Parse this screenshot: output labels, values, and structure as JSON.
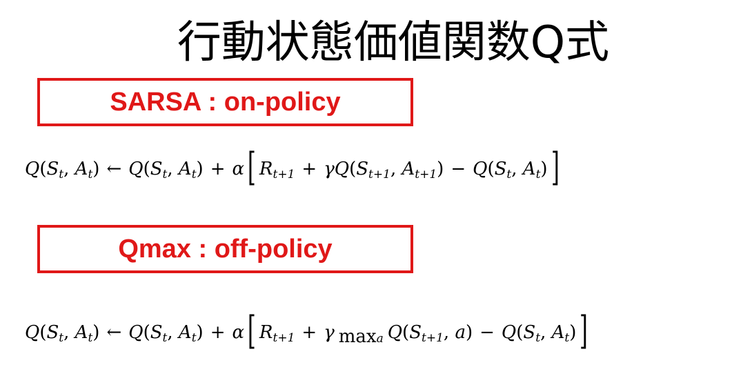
{
  "title": "行動状態価値関数Q式",
  "sections": {
    "sarsa": {
      "label": "SARSA : on-policy",
      "equation": "Q(S_t, A_t) ← Q(S_t, A_t) + α[R_{t+1} + γQ(S_{t+1}, A_{t+1}) − Q(S_t, A_t)]"
    },
    "qmax": {
      "label": "Qmax : off-policy",
      "equation": "Q(S_t, A_t) ← Q(S_t, A_t) + α[R_{t+1} + γ max_a Q(S_{t+1}, a) − Q(S_t, A_t)]"
    }
  },
  "colors": {
    "accent": "#e01818",
    "text": "#000000",
    "background": "#ffffff"
  }
}
